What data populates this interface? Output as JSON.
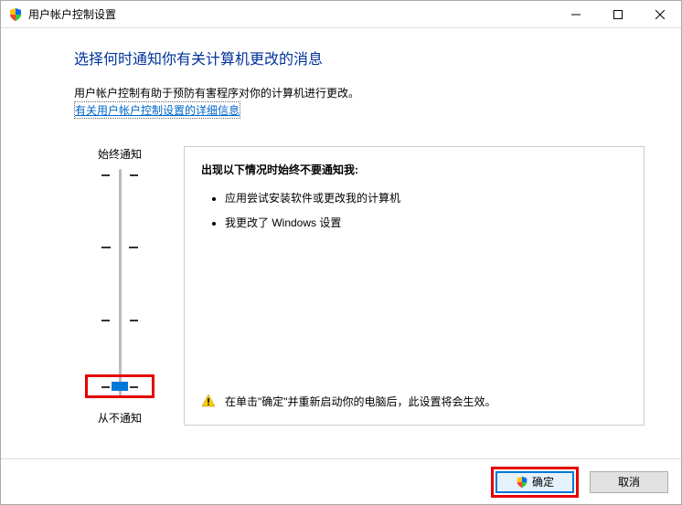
{
  "titlebar": {
    "title": "用户帐户控制设置"
  },
  "content": {
    "heading": "选择何时通知你有关计算机更改的消息",
    "desc": "用户帐户控制有助于预防有害程序对你的计算机进行更改。",
    "link": "有关用户帐户控制设置的详细信息"
  },
  "slider": {
    "top_label": "始终通知",
    "bottom_label": "从不通知"
  },
  "panel": {
    "title": "出现以下情况时始终不要通知我:",
    "items": [
      "应用尝试安装软件或更改我的计算机",
      "我更改了 Windows 设置"
    ],
    "warning": "在单击\"确定\"并重新启动你的电脑后，此设置将会生效。"
  },
  "footer": {
    "ok": "确定",
    "cancel": "取消"
  }
}
